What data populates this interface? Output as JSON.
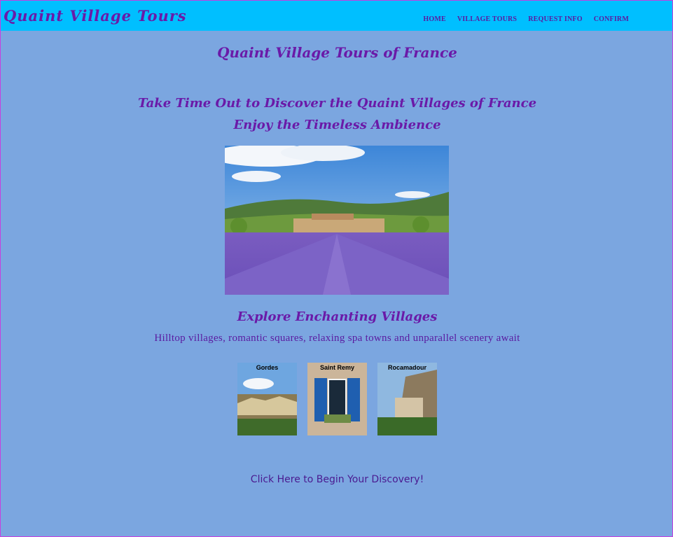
{
  "header": {
    "brand": "Quaint Village Tours",
    "nav": [
      "HOME",
      "VILLAGE TOURS",
      "REQUEST INFO",
      "CONFIRM"
    ]
  },
  "main": {
    "title": "Quaint Village Tours of France",
    "headline1": "Take Time Out to Discover the Quaint Villages of France",
    "headline2": "Enjoy the Timeless Ambience",
    "explore_heading": "Explore Enchanting Villages",
    "tagline": "Hilltop villages, romantic squares, relaxing spa towns and unparallel scenery await",
    "villages": [
      {
        "name": "Gordes"
      },
      {
        "name": "Saint Remy"
      },
      {
        "name": "Rocamadour"
      }
    ],
    "cta": "Click Here to Begin Your Discovery!"
  },
  "colors": {
    "background": "#7ba6e0",
    "header": "#00bfff",
    "text": "#6a1aa8"
  }
}
